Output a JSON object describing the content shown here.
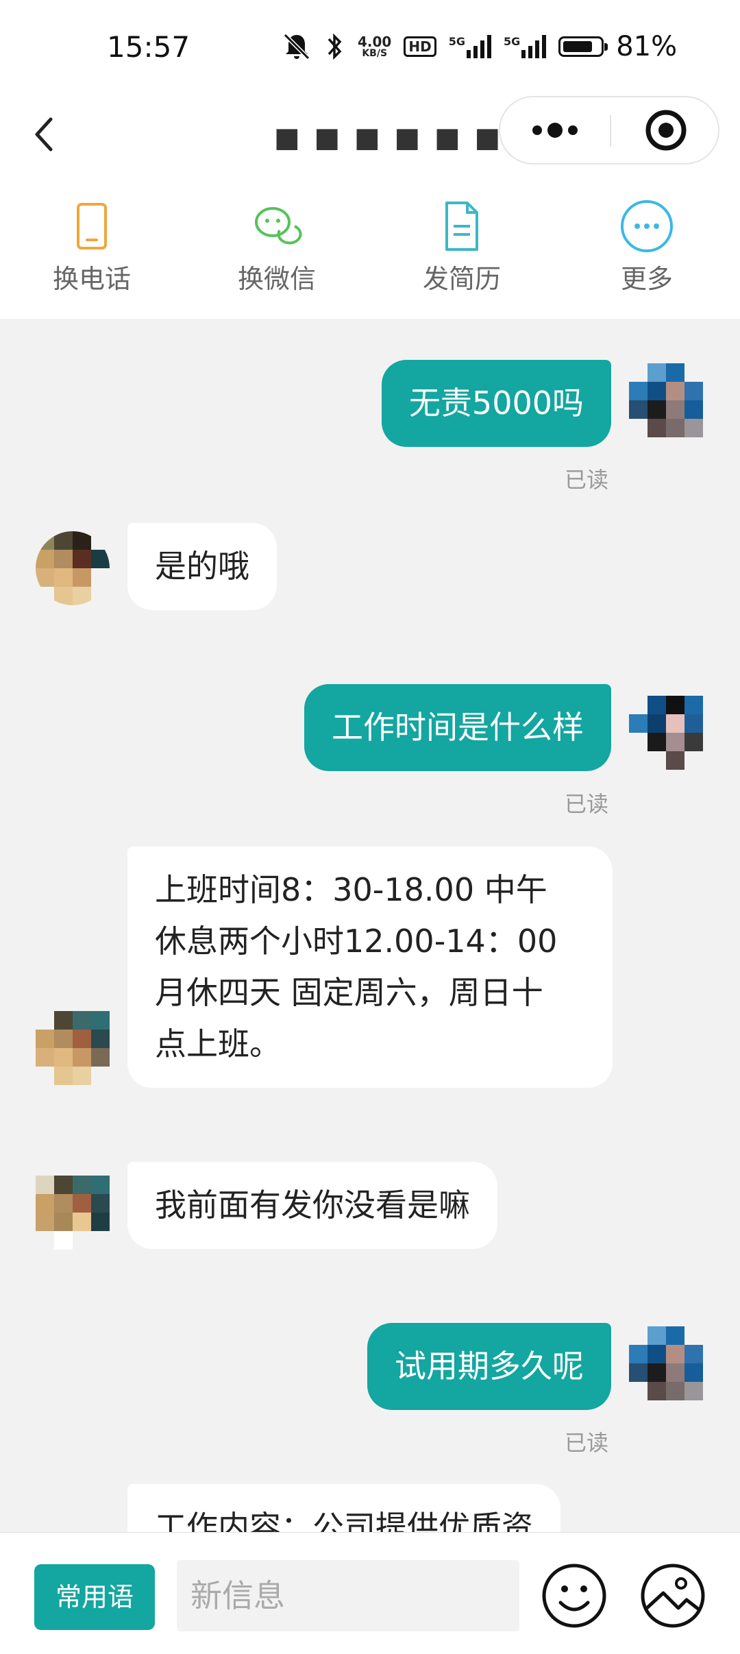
{
  "status_bar": {
    "time": "15:57",
    "net_speed_value": "4.00",
    "net_speed_unit": "KB/S",
    "hd_badge": "HD",
    "signal_1": "5G",
    "signal_2": "5G",
    "battery_percent": "81%",
    "battery_level": 0.81
  },
  "nav": {
    "title": "■ ■ ■ ■ ■ ■ ...",
    "more_icon": "more-dots-icon",
    "close_icon": "target-close-icon"
  },
  "actions": [
    {
      "label": "换电话",
      "icon": "phone-icon",
      "color": "#f0a73a"
    },
    {
      "label": "换微信",
      "icon": "wechat-icon",
      "color": "#57c25a"
    },
    {
      "label": "发简历",
      "icon": "resume-icon",
      "color": "#3cb8c4"
    },
    {
      "label": "更多",
      "icon": "more-circle-icon",
      "color": "#3cb8e6"
    }
  ],
  "messages": [
    {
      "from": "me",
      "text": "无责5000吗",
      "status": "已读"
    },
    {
      "from": "them",
      "text": "是的哦"
    },
    {
      "from": "me",
      "text": "工作时间是什么样",
      "status": "已读"
    },
    {
      "from": "them",
      "lines": [
        "上班时间8：30-18.00 中午",
        "休息两个小时12.00-14：00",
        "月休四天 固定周六，周日十",
        "点上班。"
      ]
    },
    {
      "from": "them",
      "text": "我前面有发你没看是嘛"
    },
    {
      "from": "me",
      "text": "试用期多久呢",
      "status": "已读"
    },
    {
      "from": "them",
      "text": "工作内容：公司提供优质资"
    }
  ],
  "input_bar": {
    "quick_phrases_label": "常用语",
    "placeholder": "新信息",
    "emoji_icon": "emoji-icon",
    "image_icon": "image-icon"
  },
  "colors": {
    "accent": "#14a6a0",
    "background": "#f2f2f2"
  }
}
